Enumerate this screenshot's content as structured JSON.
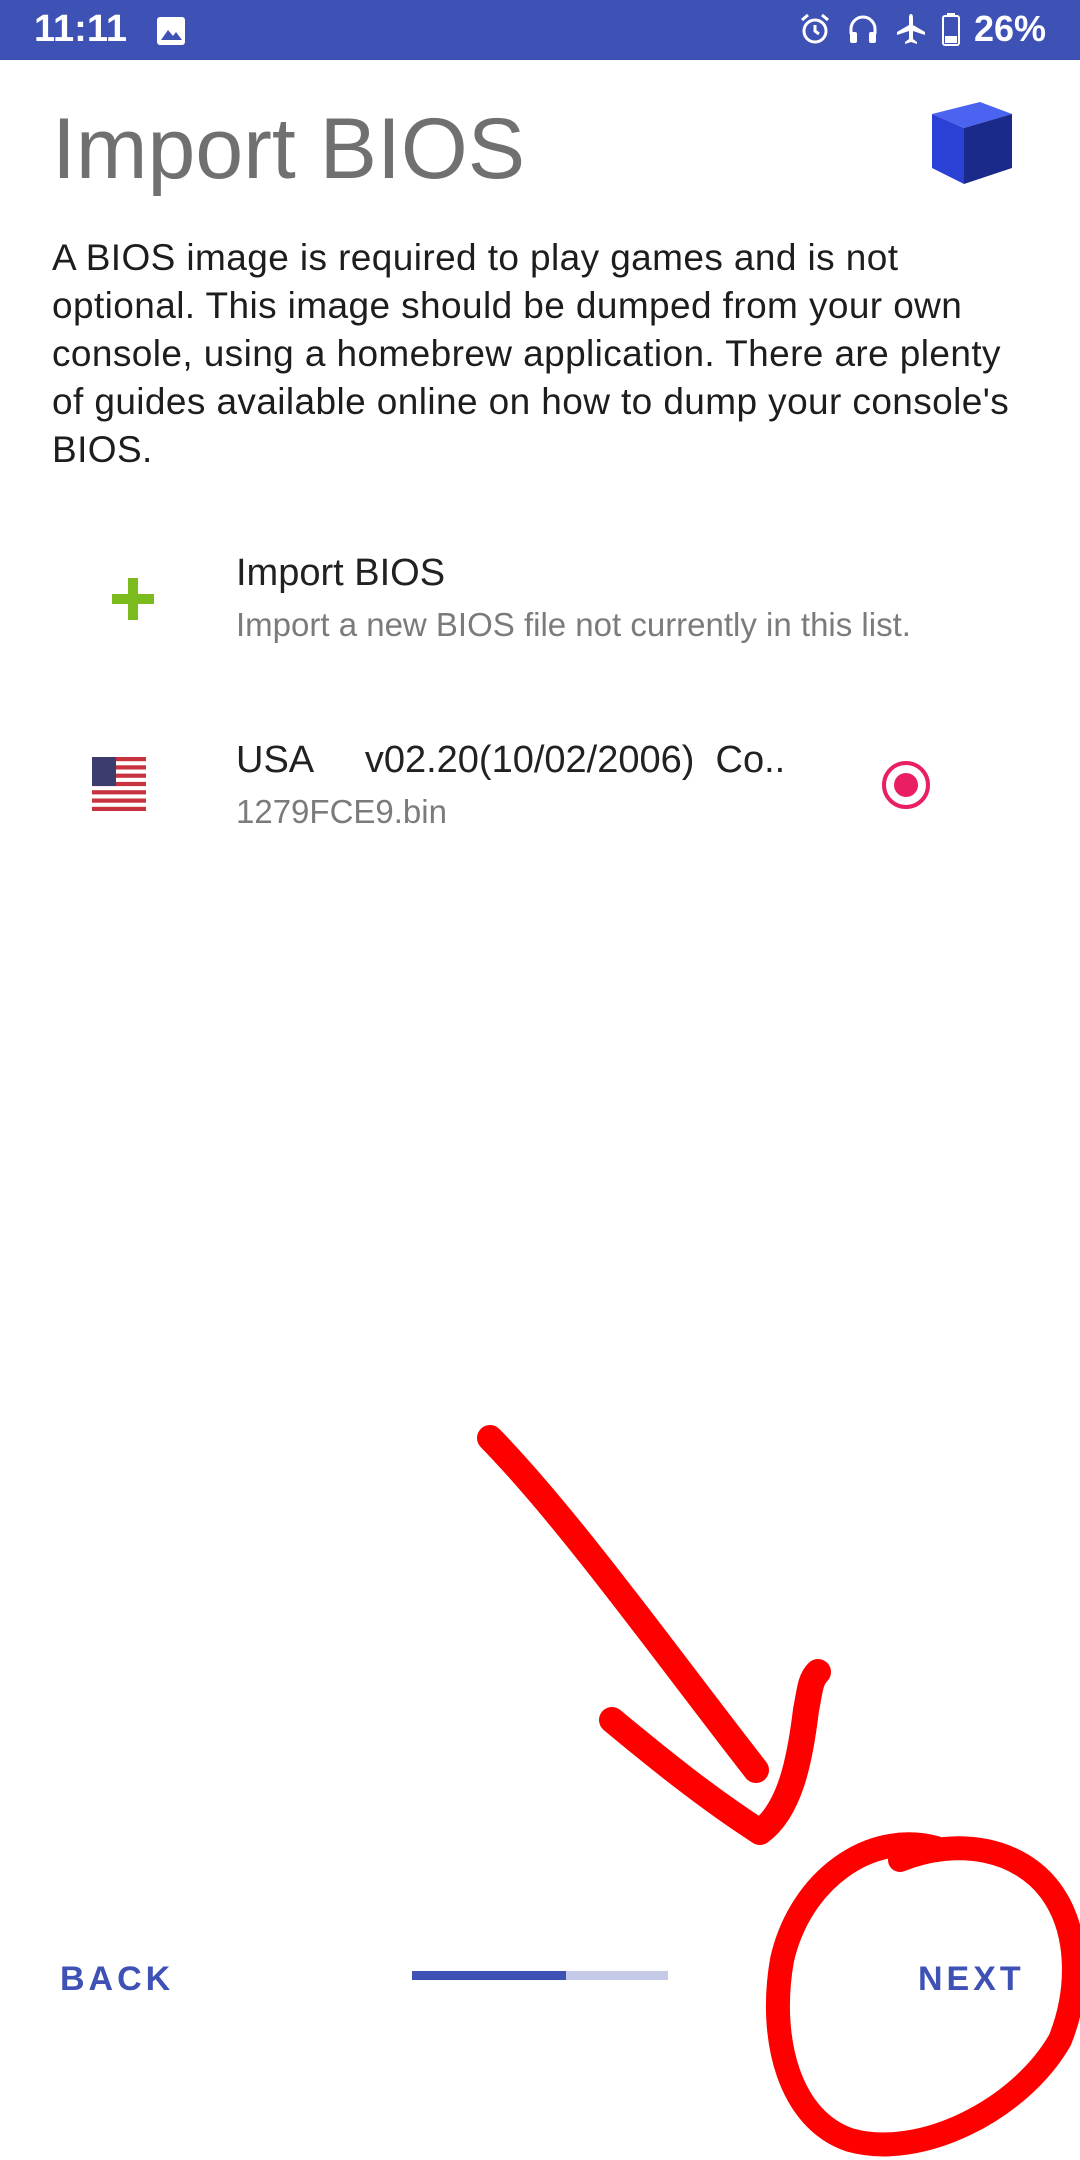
{
  "status_bar": {
    "time": "11:11",
    "battery_percent": "26%",
    "icons": [
      "image-icon",
      "alarm-icon",
      "headphones-icon",
      "airplane-icon",
      "battery-icon"
    ]
  },
  "header": {
    "title": "Import BIOS",
    "logo_icon": "cube-icon"
  },
  "description": "A BIOS image is required to play games and is not optional. This image should be dumped from your own console, using a homebrew application. There are plenty of guides available online on how to dump your console's BIOS.",
  "bios_list": [
    {
      "title": "Import BIOS",
      "subtitle": "Import a new BIOS file not currently in this list.",
      "icon": "plus-icon"
    },
    {
      "title": "USA     v02.20(10/02/2006)  Co..",
      "subtitle": "1279FCE9.bin",
      "icon": "usa-flag-icon",
      "selected": true
    }
  ],
  "footer": {
    "back_label": "BACK",
    "next_label": "NEXT",
    "progress": 0.6
  },
  "colors": {
    "primary": "#3e51b5",
    "progress_track": "#c5cae9",
    "radio_accent": "#e91e63",
    "plus": "#7cbb1e",
    "annotation": "#ff0000"
  }
}
